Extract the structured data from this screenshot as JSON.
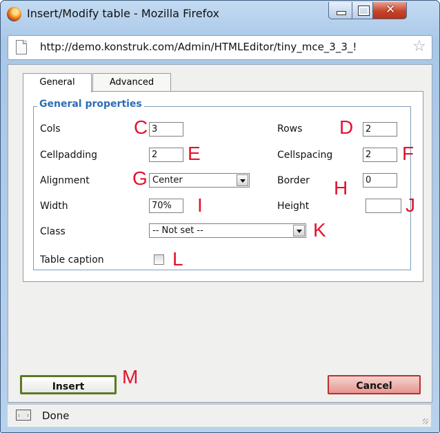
{
  "window": {
    "title": "Insert/Modify table - Mozilla Firefox",
    "url": "http://demo.konstruk.com/Admin/HTMLEditor/tiny_mce_3_3_!"
  },
  "tabs": [
    "General",
    "Advanced"
  ],
  "general_properties": {
    "legend": "General properties",
    "cols": {
      "label": "Cols",
      "value": "3"
    },
    "rows": {
      "label": "Rows",
      "value": "2"
    },
    "cellpadding": {
      "label": "Cellpadding",
      "value": "2"
    },
    "cellspacing": {
      "label": "Cellspacing",
      "value": "2"
    },
    "alignment": {
      "label": "Alignment",
      "value": "Center"
    },
    "border": {
      "label": "Border",
      "value": "0"
    },
    "width": {
      "label": "Width",
      "value": "70%"
    },
    "height": {
      "label": "Height",
      "value": ""
    },
    "class": {
      "label": "Class",
      "value": "-- Not set --"
    },
    "table_caption": {
      "label": "Table caption",
      "checked": false
    }
  },
  "annotations": {
    "c": "C",
    "d": "D",
    "e": "E",
    "f": "F",
    "g": "G",
    "h": "H",
    "i": "I",
    "j": "J",
    "k": "K",
    "l": "L",
    "m": "M"
  },
  "buttons": {
    "insert": "Insert",
    "cancel": "Cancel"
  },
  "status": {
    "text": "Done"
  },
  "colors": {
    "annotation": "#e3122d",
    "legend": "#2b6db5"
  }
}
